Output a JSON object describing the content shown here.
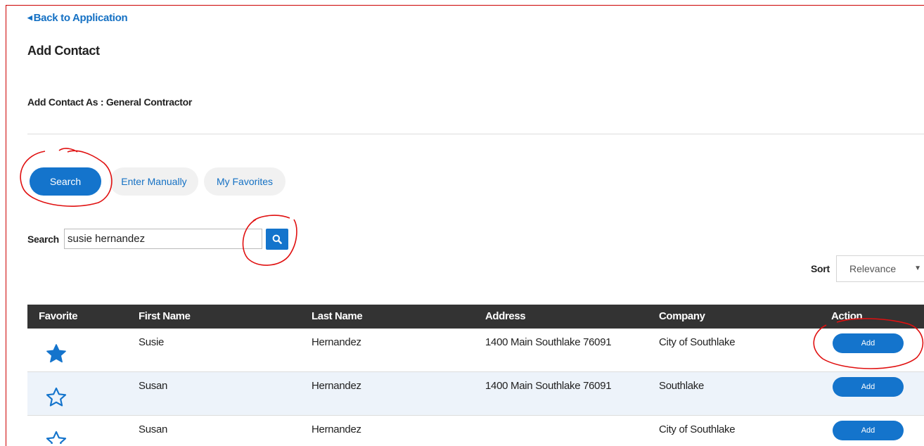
{
  "nav": {
    "back_label": "Back to Application"
  },
  "page": {
    "title": "Add Contact",
    "contact_as": "Add Contact As  : General Contractor"
  },
  "tabs": [
    {
      "label": "Search",
      "active": true
    },
    {
      "label": "Enter Manually",
      "active": false
    },
    {
      "label": "My Favorites",
      "active": false
    }
  ],
  "search": {
    "label": "Search",
    "value": "susie hernandez"
  },
  "sort": {
    "label": "Sort",
    "selected": "Relevance"
  },
  "table": {
    "headers": [
      "Favorite",
      "First Name",
      "Last Name",
      "Address",
      "Company",
      "Action"
    ],
    "rows": [
      {
        "favorite": true,
        "first_name": "Susie",
        "last_name": "Hernandez",
        "address": "1400 Main Southlake 76091",
        "company": "City of Southlake",
        "action": "Add"
      },
      {
        "favorite": false,
        "first_name": "Susan",
        "last_name": "Hernandez",
        "address": "1400 Main Southlake 76091",
        "company": "Southlake",
        "action": "Add"
      },
      {
        "favorite": false,
        "first_name": "Susan",
        "last_name": "Hernandez",
        "address": "",
        "company": "City of Southlake",
        "action": "Add"
      }
    ]
  },
  "colors": {
    "accent": "#1474cc",
    "link": "#1571c4",
    "header_bg": "#333333",
    "alt_row": "#edf3fa",
    "annotation": "#e01010"
  },
  "icons": {
    "back": "caret-left-icon",
    "search": "magnifier-icon",
    "favorite_on": "star-filled-icon",
    "favorite_off": "star-outline-icon",
    "sort": "caret-down-icon"
  }
}
